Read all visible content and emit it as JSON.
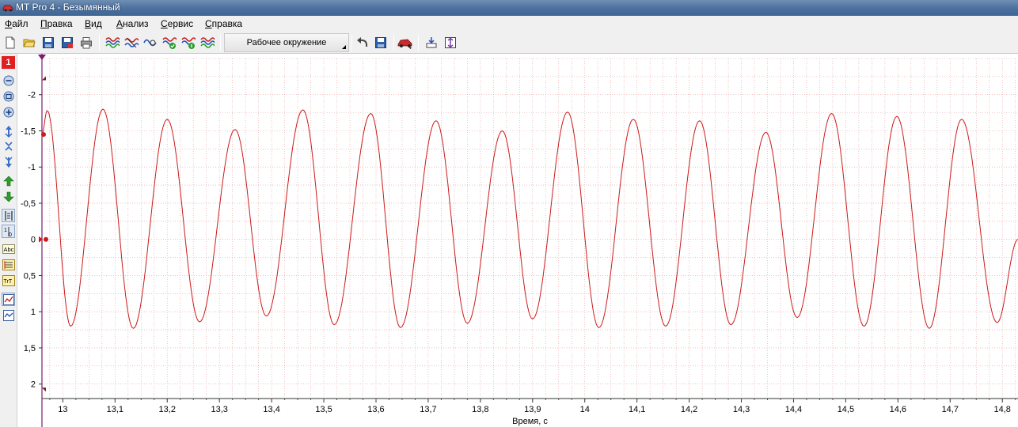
{
  "window": {
    "title": "MT Pro 4 - Безымянный"
  },
  "menu": [
    {
      "label": "Файл"
    },
    {
      "label": "Правка"
    },
    {
      "label": "Вид"
    },
    {
      "label": "Анализ"
    },
    {
      "label": "Сервис"
    },
    {
      "label": "Справка"
    }
  ],
  "toolbar": {
    "workspace_label": "Рабочее окружение",
    "buttons": [
      "new-file-icon",
      "open-folder-icon",
      "save-icon",
      "save-as-icon",
      "print-icon",
      "signal-wave-icon",
      "signal-multi-icon",
      "signal-filter-icon",
      "signal-check-icon",
      "signal-info-icon",
      "signal-sync-icon",
      "undo-icon",
      "layout-save-icon",
      "car-icon",
      "cursor-icon",
      "zoom-vertical-icon"
    ]
  },
  "left_panel": {
    "channel_number": "1",
    "buttons": [
      "zoom-out-icon",
      "zoom-fit-icon",
      "zoom-in-icon",
      "scale-up-icon",
      "scale-center-icon",
      "scale-down-icon",
      "move-up-icon",
      "move-down-icon",
      "cursor-lines-icon",
      "cursor-values-icon",
      "label-abc-icon",
      "measure-list-icon",
      "measure-ttt-icon",
      "chart-view-icon",
      "chart-alt-icon"
    ]
  },
  "colors": {
    "signal": "#cc1a1a",
    "grid": "#e59999",
    "background": "#ffffff",
    "chrome": "#f0f0f0"
  },
  "chart_data": {
    "type": "line",
    "xlabel": "Время, с",
    "ylabel": "",
    "xlim": [
      12.96,
      14.83
    ],
    "ylim": [
      2.2,
      -2.5
    ],
    "y_inverted": true,
    "grid": true,
    "x_ticks": [
      "13",
      "13,1",
      "13,2",
      "13,3",
      "13,4",
      "13,5",
      "13,6",
      "13,7",
      "13,8",
      "13,9",
      "14",
      "14,1",
      "14,2",
      "14,3",
      "14,4",
      "14,5",
      "14,6",
      "14,7",
      "14,8"
    ],
    "x_tick_values": [
      13.0,
      13.1,
      13.2,
      13.3,
      13.4,
      13.5,
      13.6,
      13.7,
      13.8,
      13.9,
      14.0,
      14.1,
      14.2,
      14.3,
      14.4,
      14.5,
      14.6,
      14.7,
      14.8
    ],
    "y_ticks": [
      "-2",
      "-1,5",
      "-1",
      "-0,5",
      "0",
      "0,5",
      "1",
      "1,5",
      "2"
    ],
    "y_tick_values": [
      -2,
      -1.5,
      -1,
      -0.5,
      0,
      0.5,
      1,
      1.5,
      2
    ],
    "series": [
      {
        "color": "#cc1a1a",
        "peaks": [
          {
            "t": 12.97,
            "v": -1.78
          },
          {
            "t": 13.077,
            "v": -1.8
          },
          {
            "t": 13.2,
            "v": -1.66
          },
          {
            "t": 13.33,
            "v": -1.52
          },
          {
            "t": 13.46,
            "v": -1.79
          },
          {
            "t": 13.59,
            "v": -1.74
          },
          {
            "t": 13.715,
            "v": -1.64
          },
          {
            "t": 13.842,
            "v": -1.5
          },
          {
            "t": 13.967,
            "v": -1.76
          },
          {
            "t": 14.093,
            "v": -1.66
          },
          {
            "t": 14.22,
            "v": -1.64
          },
          {
            "t": 14.347,
            "v": -1.48
          },
          {
            "t": 14.473,
            "v": -1.74
          },
          {
            "t": 14.598,
            "v": -1.7
          },
          {
            "t": 14.722,
            "v": -1.66
          }
        ],
        "troughs": [
          {
            "t": 13.015,
            "v": 1.2
          },
          {
            "t": 13.135,
            "v": 1.23
          },
          {
            "t": 13.262,
            "v": 1.14
          },
          {
            "t": 13.39,
            "v": 1.06
          },
          {
            "t": 13.52,
            "v": 1.18
          },
          {
            "t": 13.647,
            "v": 1.22
          },
          {
            "t": 13.775,
            "v": 1.16
          },
          {
            "t": 13.9,
            "v": 1.1
          },
          {
            "t": 14.027,
            "v": 1.22
          },
          {
            "t": 14.155,
            "v": 1.2
          },
          {
            "t": 14.28,
            "v": 1.18
          },
          {
            "t": 14.407,
            "v": 1.08
          },
          {
            "t": 14.535,
            "v": 1.2
          },
          {
            "t": 14.66,
            "v": 1.23
          },
          {
            "t": 14.79,
            "v": 1.15
          }
        ],
        "end": {
          "t": 14.83,
          "v": 0.0
        }
      }
    ]
  }
}
